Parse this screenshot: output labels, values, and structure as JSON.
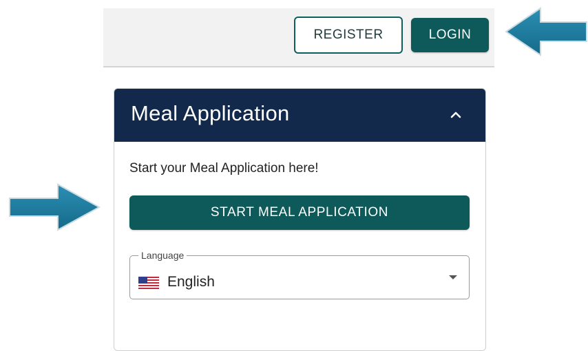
{
  "header": {
    "register_label": "REGISTER",
    "login_label": "LOGIN"
  },
  "card": {
    "title": "Meal Application",
    "collapse_icon": "chevron-up-icon",
    "intro_text": "Start your Meal Application here!",
    "start_button_label": "START MEAL APPLICATION"
  },
  "language": {
    "label": "Language",
    "selected": "English",
    "flag_icon": "us-flag-icon",
    "dropdown_icon": "caret-down-icon"
  },
  "annotations": {
    "arrow_color": "#1f7a9c",
    "arrows": [
      "arrow-pointing-left-icon",
      "arrow-pointing-right-icon"
    ]
  },
  "colors": {
    "header_navy": "#12294b",
    "button_teal": "#0e5a5a"
  }
}
